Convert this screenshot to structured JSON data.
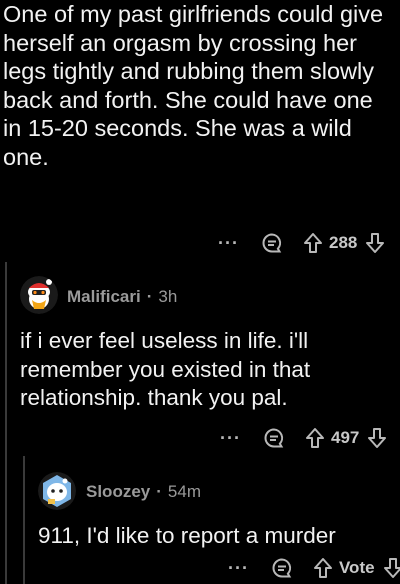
{
  "top_comment": {
    "text": "One of my past girlfriends could give herself an orgasm by crossing her legs tightly and rubbing them slowly back and forth. She could have one in 15-20 seconds. She was a wild one.",
    "more": "···",
    "score": "288"
  },
  "reply1": {
    "author": "Malificari",
    "separator": "·",
    "age": "3h",
    "text": "if i ever feel useless in life. i'll remember you existed in that relationship. thank you pal.",
    "more": "···",
    "score": "497"
  },
  "reply2": {
    "author": "Sloozey",
    "separator": "·",
    "age": "54m",
    "text": "911, I'd like to report a murder",
    "more": "···",
    "score": "Vote"
  },
  "colors": {
    "background": "#000000",
    "text": "#f2f2f2",
    "muted": "#9a9a9a",
    "thread_line": "#3a3a3a"
  },
  "icons": [
    "reply-icon",
    "upvote-icon",
    "downvote-icon",
    "snoo-avatar-icon"
  ]
}
